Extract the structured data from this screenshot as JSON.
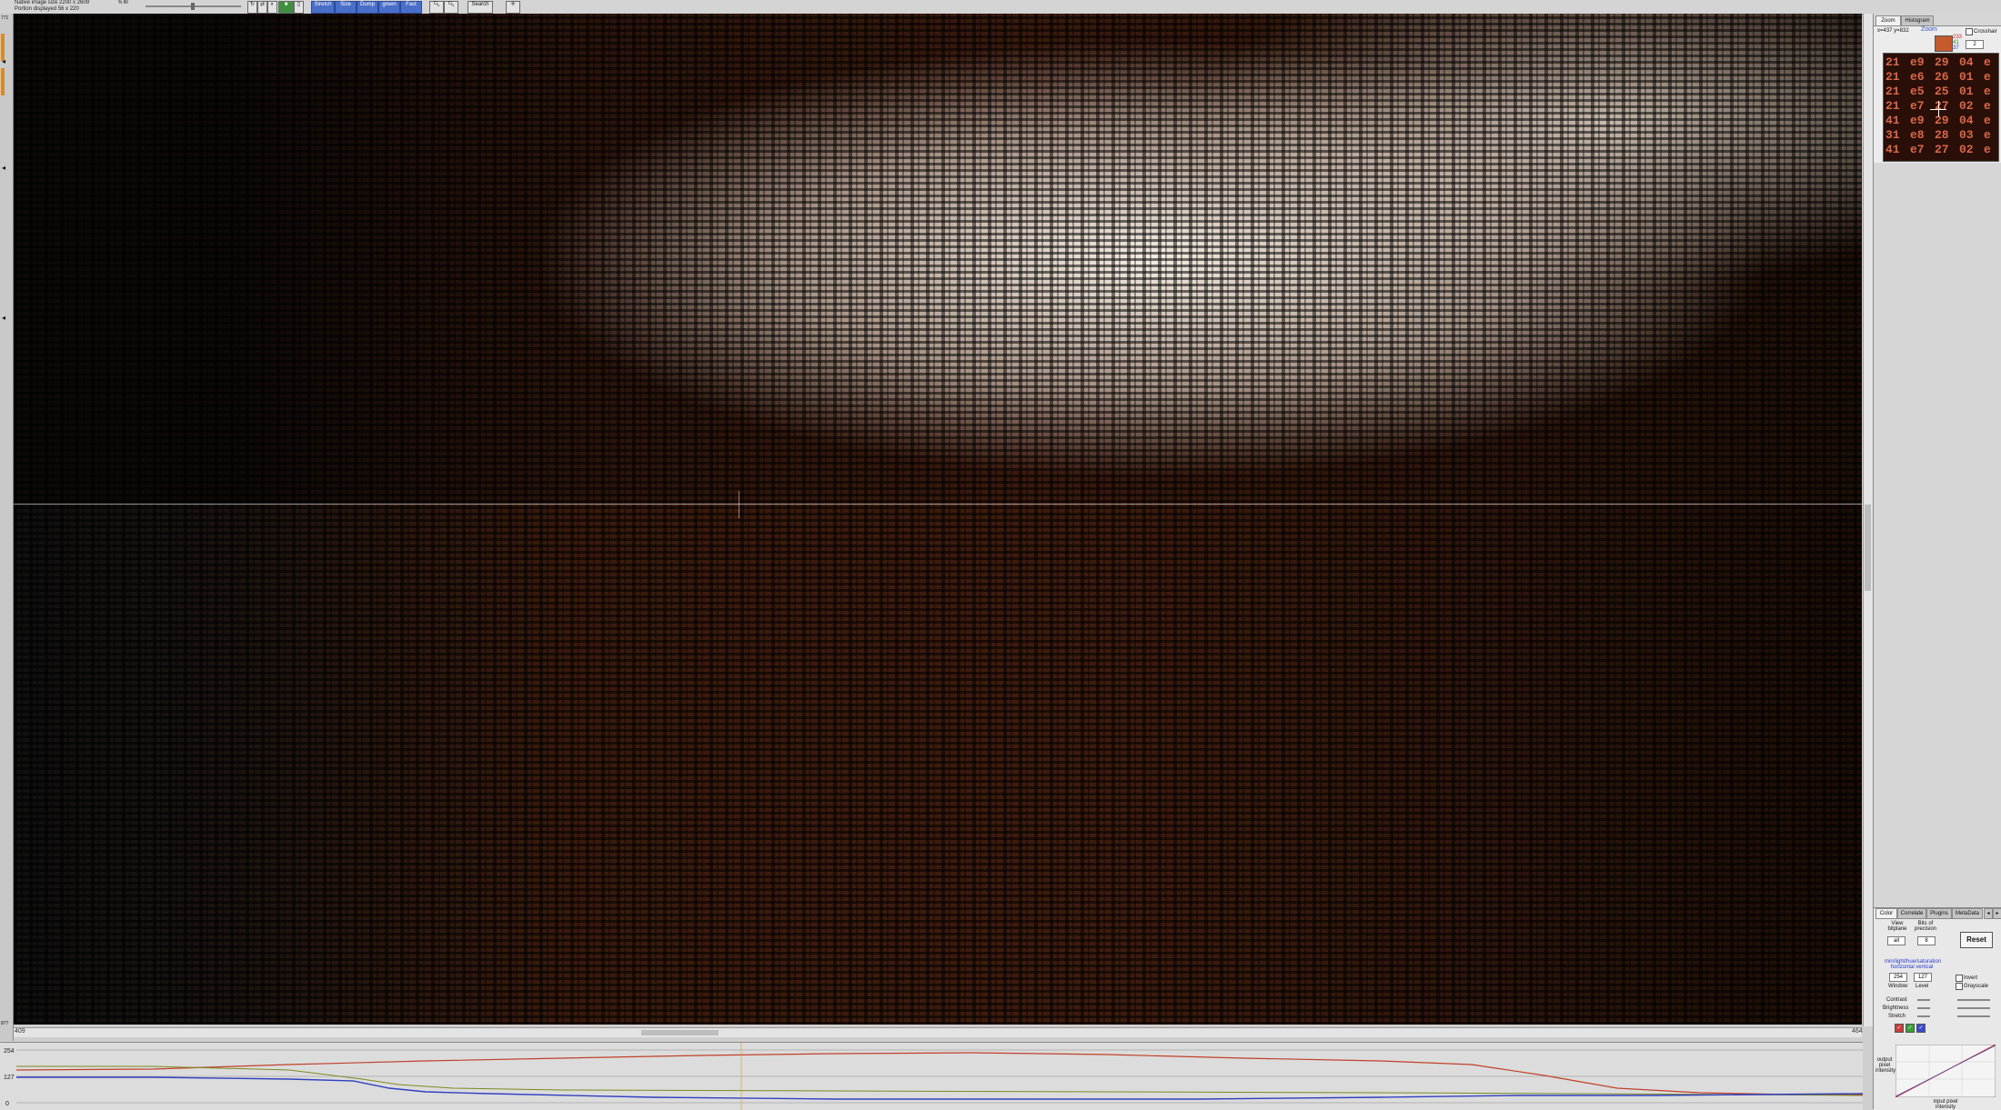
{
  "toolbar": {
    "info_line1": "Native image size   2200   x   2609",
    "info_line2": "Portion displayed     56   x   220",
    "zoom_label": "% fill",
    "mode_label": "no frame",
    "btn_stretch": "Stretch",
    "btn_size": "Size",
    "btn_dump": "Dump",
    "btn_green": "green",
    "btn_fast": "Fast",
    "btn_search": "Search",
    "zoom_in": "+",
    "zoom_out": "-"
  },
  "canvas": {
    "row_start": "771",
    "row_end": "877",
    "col_start": "409",
    "col_end": "464"
  },
  "profile": {
    "y_max": "254",
    "y_mid": "127",
    "y_min": "0"
  },
  "right_panel": {
    "tabs_top": [
      "Zoom",
      "Histogram"
    ],
    "coord": "x=437 y=832",
    "zoom_title": "Zoom",
    "swatch_values": [
      "233",
      "41",
      "37"
    ],
    "crosshair_label": "Crosshair",
    "zoom_factor": "2",
    "zoom_cells": [
      [
        "21",
        "e9",
        "29",
        "04",
        "e"
      ],
      [
        "21",
        "e6",
        "26",
        "01",
        "e"
      ],
      [
        "21",
        "e5",
        "25",
        "01",
        "e"
      ],
      [
        "21",
        "e7",
        "27",
        "02",
        "e"
      ],
      [
        "41",
        "e9",
        "29",
        "04",
        "e"
      ],
      [
        "31",
        "e8",
        "28",
        "03",
        "e"
      ],
      [
        "41",
        "e7",
        "27",
        "02",
        "e"
      ]
    ],
    "tabs_bottom": [
      "Color",
      "Correlate",
      "Plugins",
      "MetaData"
    ],
    "view_bitplane": "View bitplane",
    "bits_precision": "Bits of precision",
    "bitplane_value": "all",
    "precision_value": "8",
    "reset": "Reset",
    "link_text": "min/light/hue/saturation",
    "link_text2": "horizontal  vertical",
    "window_value": "254",
    "level_value": "127",
    "window_label": "Window",
    "level_label": "Level",
    "invert": "Invert",
    "grayscale": "Grayscale",
    "contrast": "Contrast",
    "brightness": "Brightness",
    "stretch": "Stretch",
    "output_label": "output pixel intensity",
    "input_label": "input pixel intensity"
  }
}
